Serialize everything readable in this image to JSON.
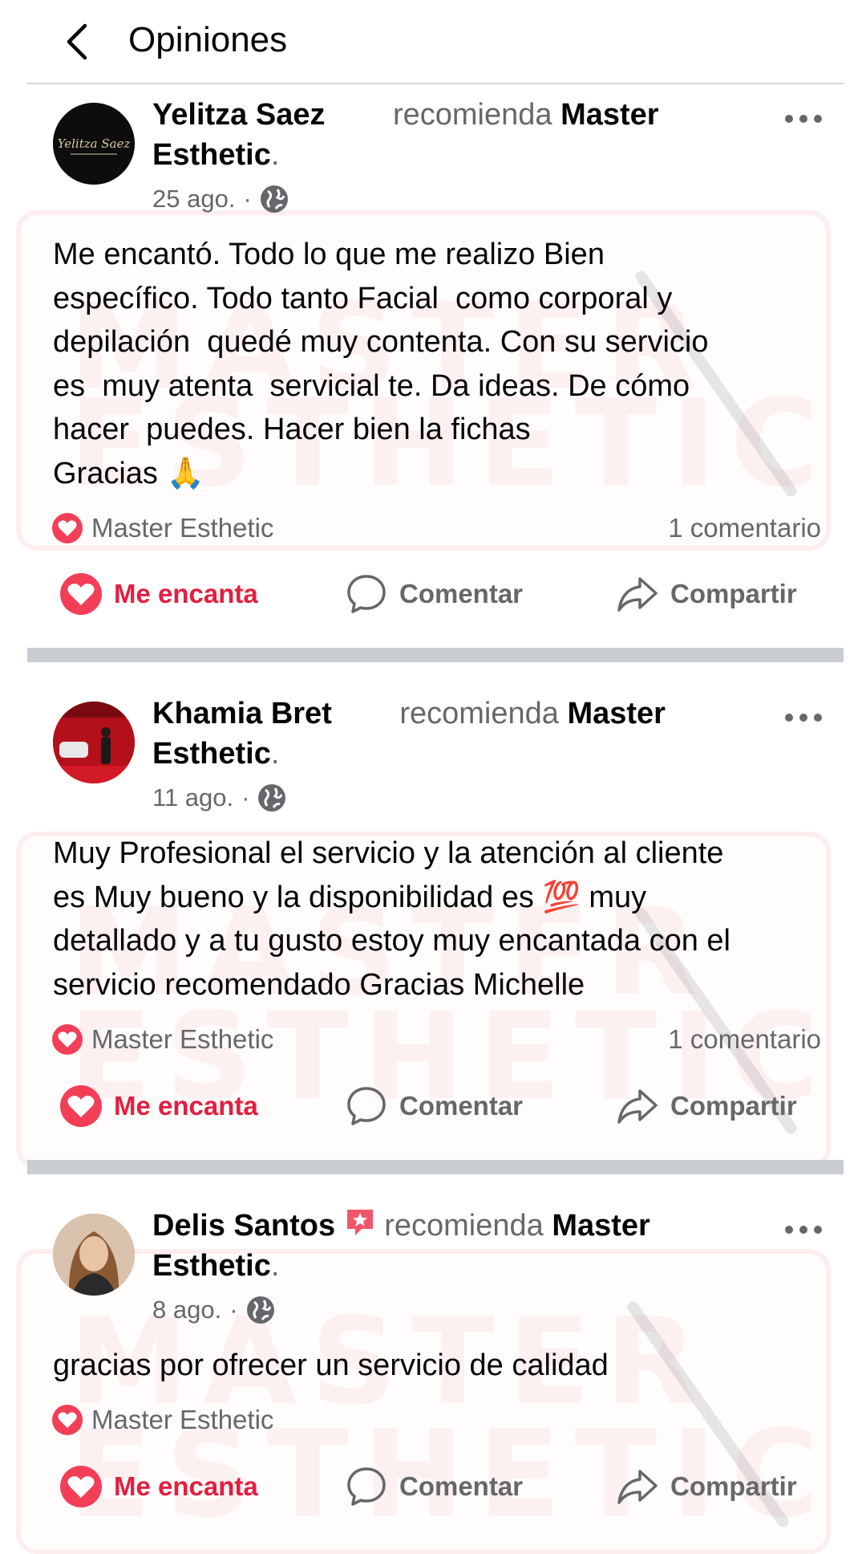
{
  "header": {
    "title": "Opiniones"
  },
  "posts": [
    {
      "author": "Yelitza Saez",
      "recommends": "recomienda",
      "page_line1": "Master",
      "page_line2": "Esthetic",
      "date": "25 ago.",
      "separator": "·",
      "body": "Me encantó. Todo lo que me realizo Bien\nespecífico. Todo tanto Facial  como corporal y\ndepilación  quedé muy contenta. Con su servicio\nes  muy atenta  servicial te. Da ideas. De cómo\nhacer  puedes. Hacer bien la fichas\nGracias 🙏",
      "reaction_name": "Master Esthetic",
      "comments": "1 comentario",
      "avatar_color": "#0d0d0d"
    },
    {
      "author": "Khamia Bret",
      "recommends": "recomienda",
      "page_line1": "Master",
      "page_line2": "Esthetic",
      "date": "11 ago.",
      "separator": "·",
      "body": "Muy Profesional el servicio y la atención al cliente\nes Muy bueno y la disponibilidad es 💯 muy\ndetallado y a tu gusto estoy muy encantada con el\nservicio recomendado Gracias Michelle",
      "reaction_name": "Master Esthetic",
      "comments": "1 comentario",
      "avatar_color": "#b3101c"
    },
    {
      "author": "Delis Santos",
      "recommends": "recomienda",
      "page_line1": "Master",
      "page_line2": "Esthetic",
      "date": "8 ago.",
      "separator": "·",
      "body": "gracias por ofrecer un servicio de calidad",
      "reaction_name": "Master Esthetic",
      "comments": "",
      "avatar_color": "#c7a07a"
    }
  ],
  "actions": {
    "love": "Me encanta",
    "comment": "Comentar",
    "share": "Compartir"
  },
  "watermark": {
    "line1": "MASTER",
    "line2": "ESTHETIC"
  },
  "colors": {
    "love_red": "#e41e3f",
    "secondary_text": "#65676b",
    "separator": "#c9ccd1"
  },
  "icons": {
    "back": "chevron-left-icon",
    "more": "more-dots-icon",
    "audience": "globe-icon",
    "reaction": "heart-icon",
    "comment": "comment-bubble-icon",
    "share": "share-arrow-icon",
    "badge": "star-badge-icon"
  }
}
